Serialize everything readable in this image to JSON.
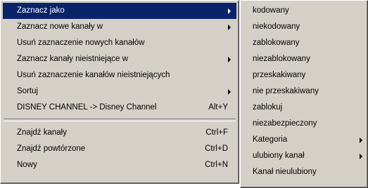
{
  "main_menu": {
    "items": [
      {
        "label": "Zaznacz jako",
        "submenu": true,
        "highlighted": true
      },
      {
        "label": "Zaznacz nowe kanały w",
        "submenu": true
      },
      {
        "label": "Usuń zaznaczenie nowych kanałów"
      },
      {
        "label": "Zaznacz kanały nieistniejące w",
        "submenu": true
      },
      {
        "label": "Usuń zaznaczenie kanałów nieistniejących"
      },
      {
        "label": "Sortuj",
        "submenu": true
      },
      {
        "label": "DISNEY CHANNEL -> Disney Channel",
        "shortcut": "Alt+Y"
      }
    ],
    "items_after_separator": [
      {
        "label": "Znajdź kanały",
        "shortcut": "Ctrl+F"
      },
      {
        "label": "Znajdź powtórzone",
        "shortcut": "Ctrl+D"
      },
      {
        "label": "Nowy",
        "shortcut": "Ctrl+N"
      }
    ]
  },
  "sub_menu": {
    "items": [
      {
        "label": "kodowany"
      },
      {
        "label": "niekodowany"
      },
      {
        "label": "zablokowany"
      },
      {
        "label": "niezablokowany"
      },
      {
        "label": "przeskakiwany"
      },
      {
        "label": "nie przeskakiwany"
      },
      {
        "label": "zablokuj"
      },
      {
        "label": "niezabezpieczony"
      },
      {
        "label": "Kategoria",
        "submenu": true
      },
      {
        "label": "ulubiony kanał",
        "submenu": true
      },
      {
        "label": "Kanał nieulubiony"
      }
    ]
  },
  "colors": {
    "menu_background": "#d4d0c8",
    "highlight": "#0a246a",
    "highlight_text": "#ffffff"
  }
}
